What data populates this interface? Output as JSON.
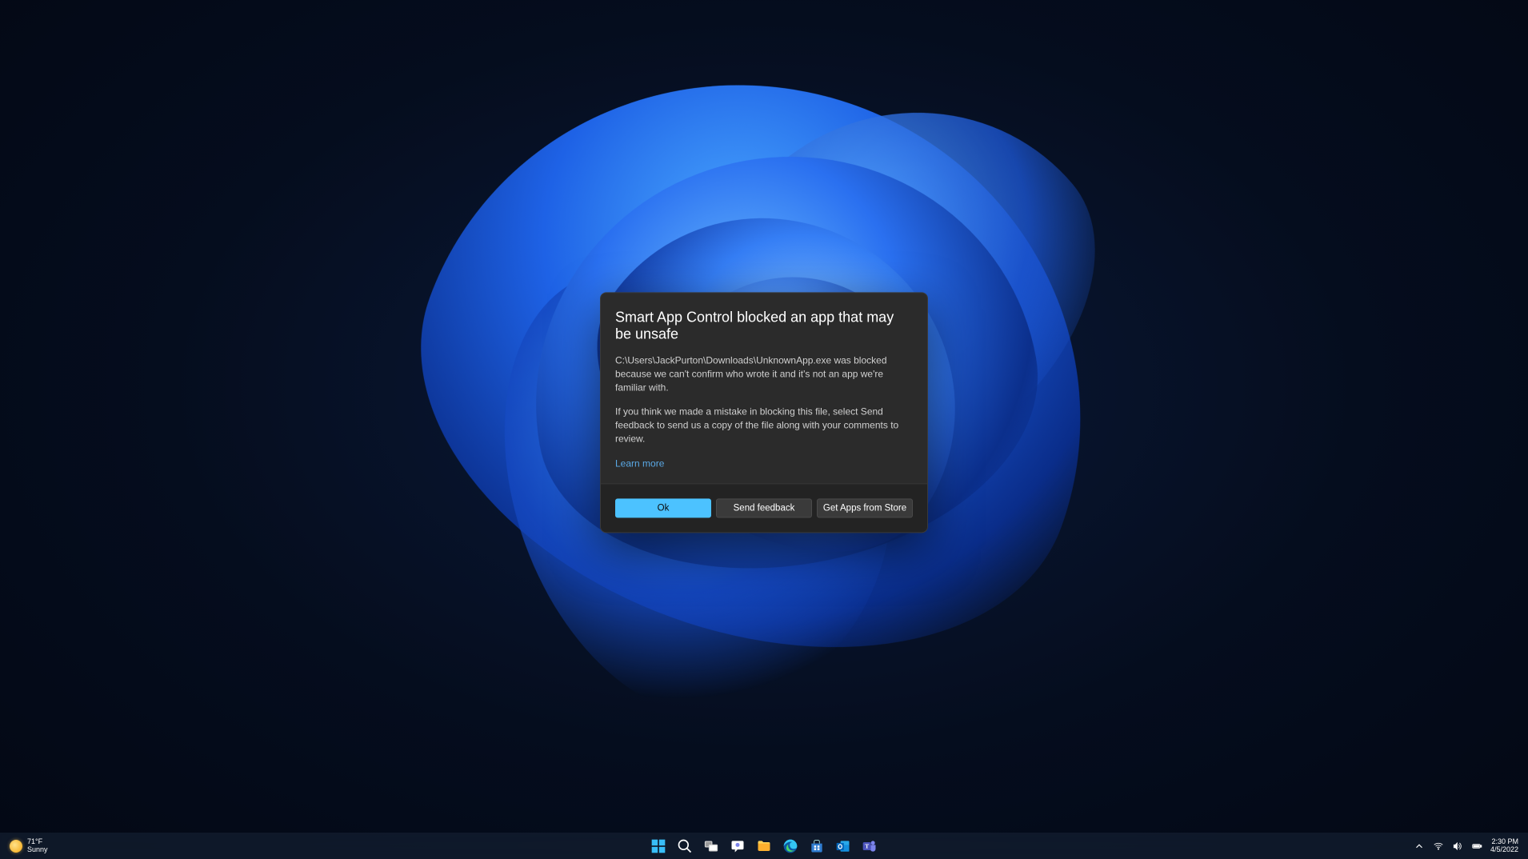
{
  "dialog": {
    "title": "Smart App Control blocked an app that may be unsafe",
    "body1": "C:\\Users\\JackPurton\\Downloads\\UnknownApp.exe was blocked because we can't confirm who wrote it and it's not an app we're familiar with.",
    "body2": "If you think we made a mistake in blocking this file, select Send feedback to send us a copy of the file along with your comments to review.",
    "learn_more": "Learn more",
    "ok": "Ok",
    "send_feedback": "Send feedback",
    "get_apps": "Get Apps from Store"
  },
  "taskbar": {
    "weather_temp": "71°F",
    "weather_cond": "Sunny",
    "time": "2:30 PM",
    "date": "4/5/2022"
  }
}
